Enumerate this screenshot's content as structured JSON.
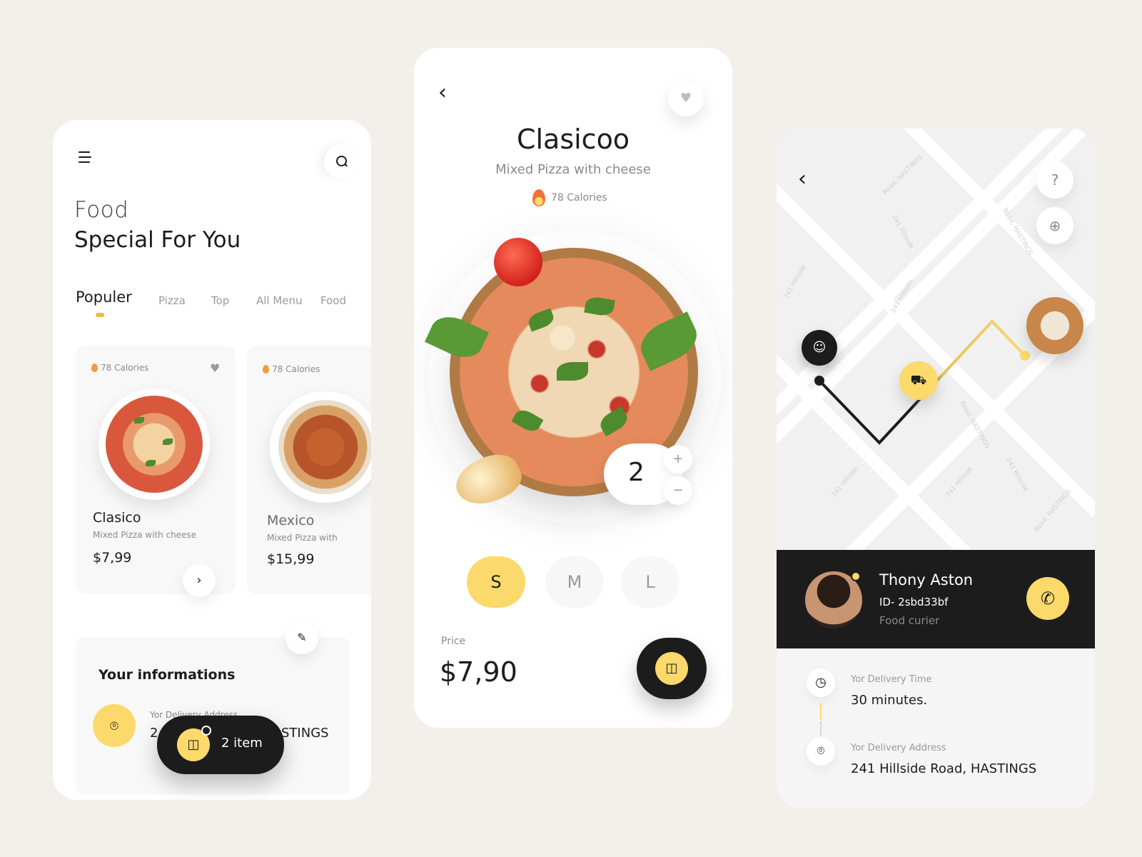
{
  "home": {
    "heading_light": "Food",
    "heading_bold": "Special For You",
    "tabs": [
      {
        "label": "Populer",
        "active": true
      },
      {
        "label": "Pizza",
        "active": false
      },
      {
        "label": "Top",
        "active": false
      },
      {
        "label": "All Menu",
        "active": false
      },
      {
        "label": "Food",
        "active": false
      }
    ],
    "cards": [
      {
        "calories": "78 Calories",
        "title": "Clasico",
        "subtitle": "Mixed Pizza with cheese",
        "price": "$7,99"
      },
      {
        "calories": "78 Calories",
        "title": "Mexico",
        "subtitle": "Mixed Pizza with",
        "price": "$15,99"
      }
    ],
    "info": {
      "title": "Your informations",
      "address_label": "Yor Delivery Address",
      "address_start": "2",
      "address_end": "STINGS"
    },
    "cart": {
      "label": "2 item"
    }
  },
  "detail": {
    "title": "Clasicoo",
    "subtitle": "Mixed Pizza with cheese",
    "calories": "78 Calories",
    "quantity": "2",
    "plus": "+",
    "minus": "−",
    "sizes": [
      {
        "label": "S",
        "active": true
      },
      {
        "label": "M",
        "active": false
      },
      {
        "label": "L",
        "active": false
      }
    ],
    "price_label": "Price",
    "price": "$7,90"
  },
  "tracking": {
    "map_labels": [
      "Road, HASTINGS",
      "241 Hillside",
      "Road, HASTINGS",
      "241 Hillside",
      "241 Hillside",
      "Road, HASTINGS",
      "241 Hillside",
      "241 Hillside",
      "241 Hillside",
      "Road, HASTINGS"
    ],
    "courier": {
      "name": "Thony Aston",
      "id": "ID- 2sbd33bf",
      "role": "Food curier"
    },
    "delivery_time_label": "Yor Delivery Time",
    "delivery_time": "30 minutes.",
    "delivery_address_label": "Yor Delivery Address",
    "delivery_address": "241 Hillside Road, HASTINGS"
  },
  "colors": {
    "accent": "#fbd96b",
    "dark": "#1c1c1c",
    "background": "#f3f0ec",
    "flame": "#f39a3a"
  },
  "icons": [
    "menu-icon",
    "search-icon",
    "heart-icon",
    "flame-icon",
    "chevron-right-icon",
    "edit-icon",
    "location-pin-icon",
    "shopping-bag-icon",
    "back-icon",
    "help-icon",
    "crosshair-icon",
    "motorbike-icon",
    "phone-icon",
    "clock-icon"
  ]
}
